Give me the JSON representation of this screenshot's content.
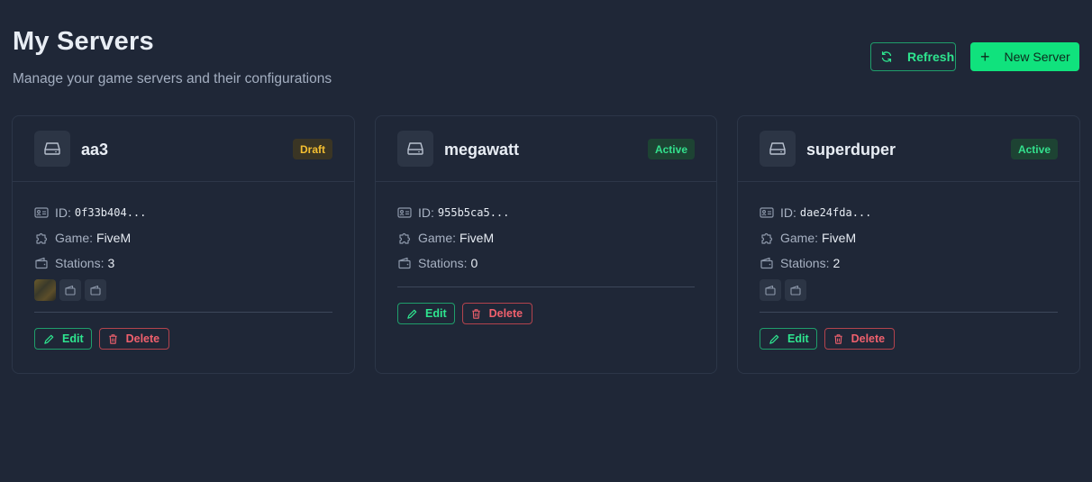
{
  "header": {
    "title": "My Servers",
    "subtitle": "Manage your game servers and their configurations"
  },
  "actions": {
    "refresh_label": "Refresh",
    "new_label": "New Server",
    "new_icon": "+"
  },
  "labels": {
    "id": "ID:",
    "game": "Game:",
    "stations": "Stations:",
    "edit": "Edit",
    "delete": "Delete"
  },
  "colors": {
    "accent": "#10e27d",
    "danger": "#f0606d",
    "draft": "#f4bf31"
  },
  "servers": [
    {
      "name": "aa3",
      "status": "Draft",
      "id": "0f33b404...",
      "game": "FiveM",
      "stations": "3"
    },
    {
      "name": "megawatt",
      "status": "Active",
      "id": "955b5ca5...",
      "game": "FiveM",
      "stations": "0"
    },
    {
      "name": "superduper",
      "status": "Active",
      "id": "dae24fda...",
      "game": "FiveM",
      "stations": "2"
    }
  ]
}
